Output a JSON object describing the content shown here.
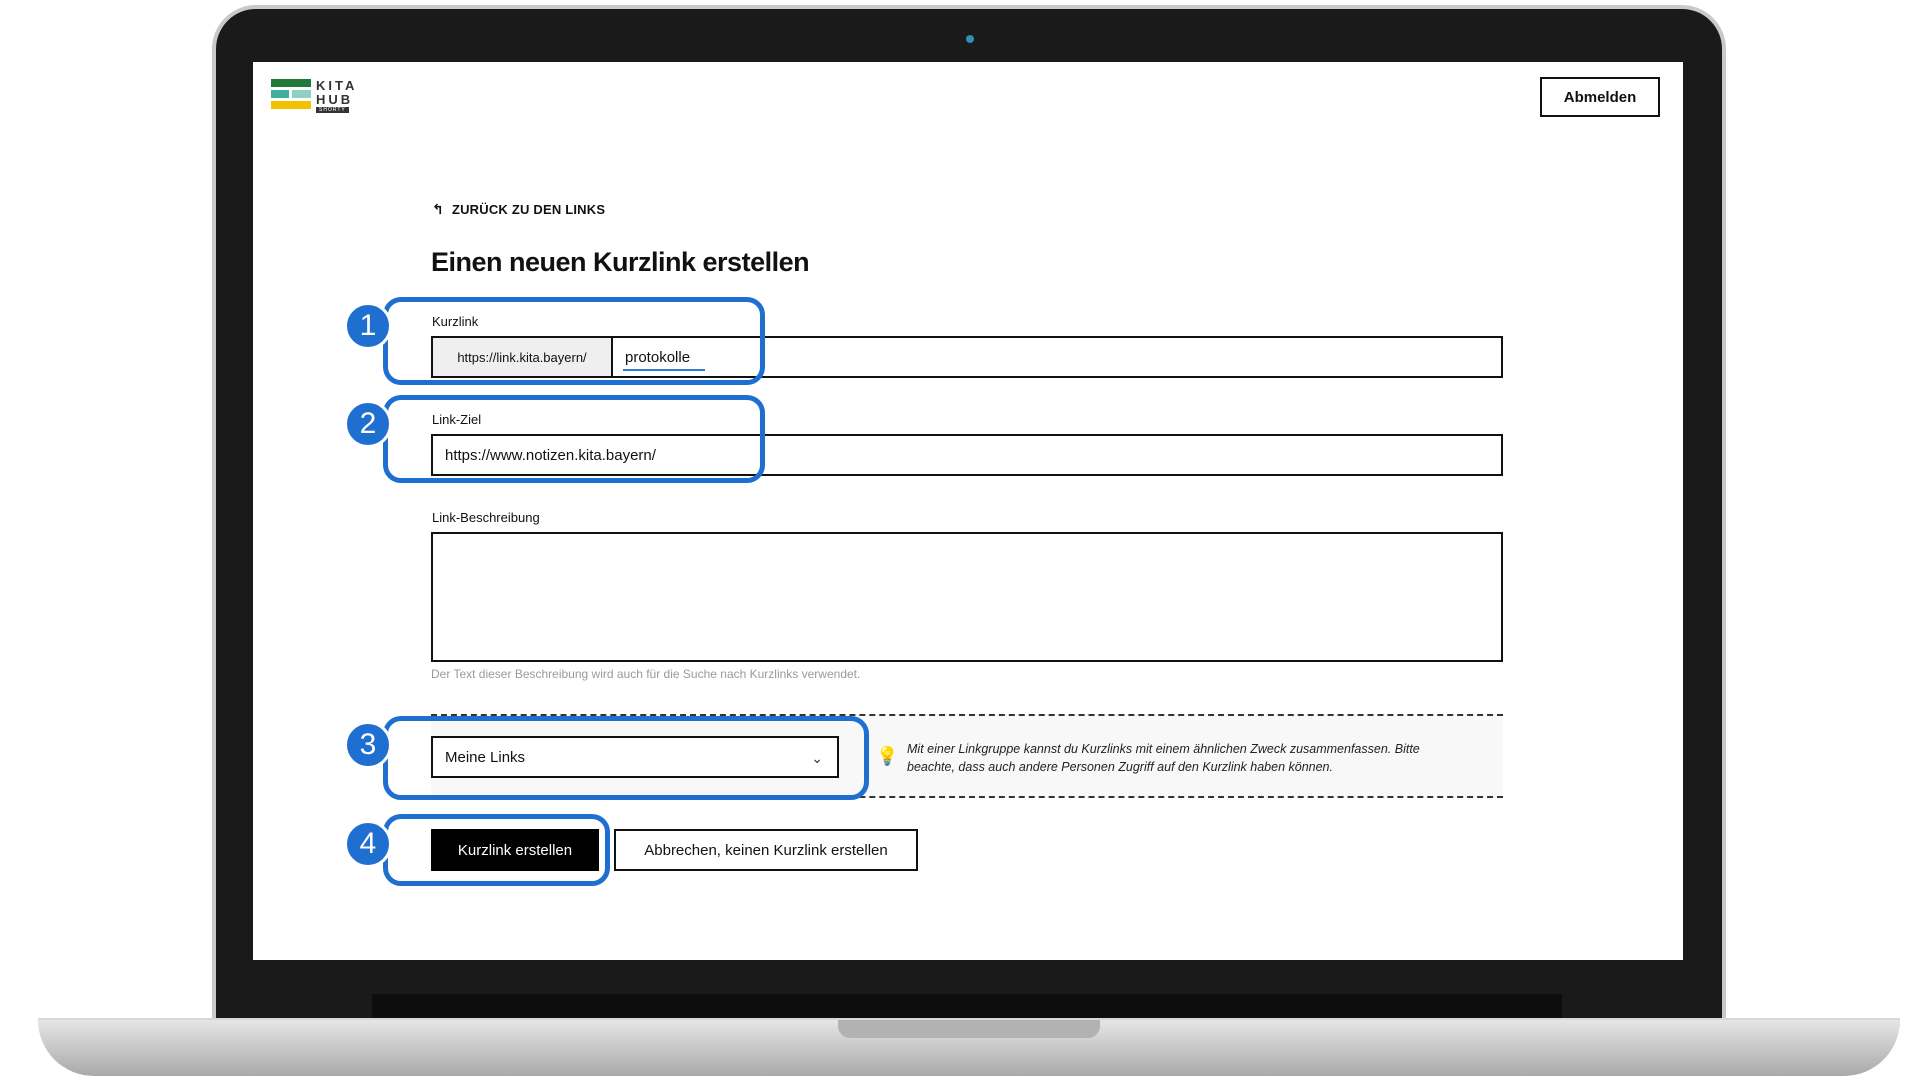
{
  "header": {
    "logo_text_line1": "KITA",
    "logo_text_line2": "HUB",
    "logo_sub": "SHORTY",
    "logout_label": "Abmelden"
  },
  "nav": {
    "back_label": "ZURÜCK ZU DEN LINKS"
  },
  "form": {
    "title": "Einen neuen Kurzlink erstellen",
    "shortlink_label": "Kurzlink",
    "shortlink_prefix": "https://link.kita.bayern/",
    "shortlink_value": "protokolle",
    "target_label": "Link-Ziel",
    "target_value": "https://www.notizen.kita.bayern/",
    "description_label": "Link-Beschreibung",
    "description_value": "",
    "description_hint": "Der Text dieser Beschreibung wird auch für die Suche nach Kurzlinks verwendet.",
    "group_selected": "Meine Links",
    "group_info": "Mit einer Linkgruppe kannst du Kurzlinks mit einem ähnlichen Zweck zusammenfassen. Bitte beachte, dass auch andere Personen Zugriff auf den Kurzlink haben können.",
    "submit_label": "Kurzlink erstellen",
    "cancel_label": "Abbrechen, keinen Kurzlink erstellen"
  },
  "callouts": [
    "1",
    "2",
    "3",
    "4"
  ],
  "colors": {
    "callout": "#1f6fd1",
    "primary_button": "#000000",
    "logo_green": "#1f7a3a",
    "logo_teal": "#3fae9d",
    "logo_yellow": "#f2c200"
  }
}
